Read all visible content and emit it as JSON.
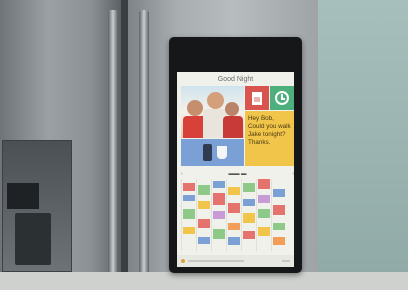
{
  "device": {
    "greeting": "Good Night",
    "note_lines": [
      "Hey Bob,",
      "Could you walk",
      "Jake tonight?",
      "Thanks."
    ]
  },
  "colors": {
    "note_yellow": "#f0c54a",
    "calendar_tile": "#d9534f",
    "clock_tile": "#4caf7c",
    "music_tile": "#7aa0d6"
  },
  "icons": [
    "calendar-icon",
    "clock-icon",
    "speaker-icon",
    "coffee-cup-icon"
  ]
}
